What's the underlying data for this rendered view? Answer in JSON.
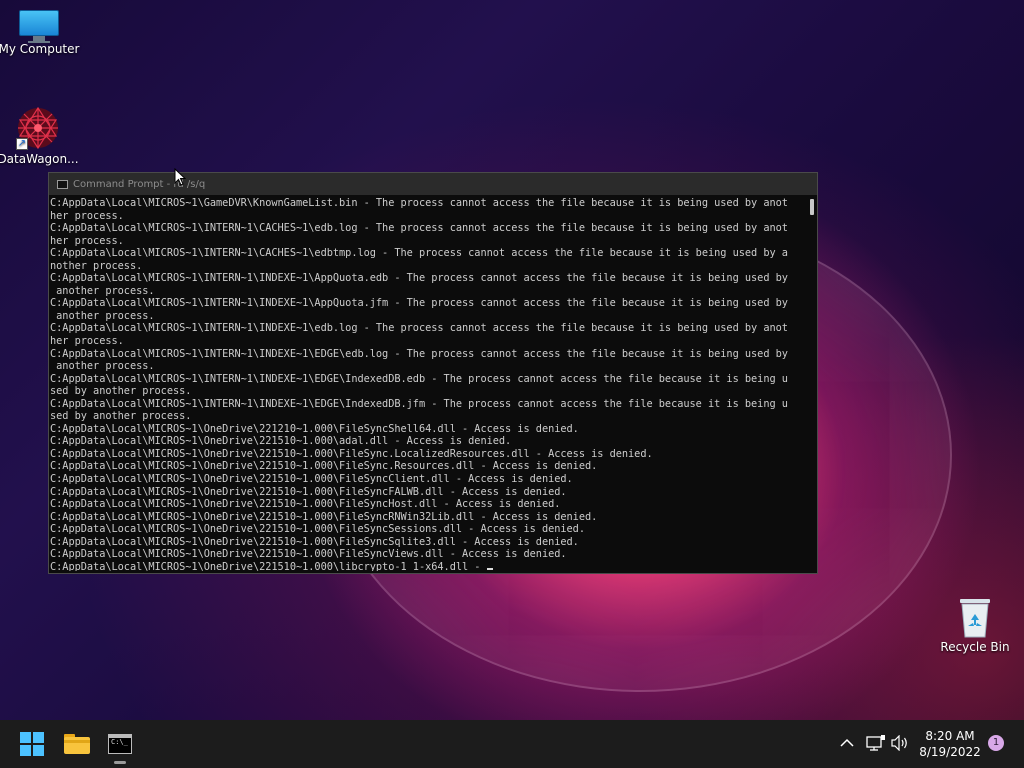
{
  "desktop": {
    "icons": [
      {
        "label": "My Computer",
        "icon": "monitor-icon"
      },
      {
        "label": "DataWagon...",
        "icon": "datawagon-icon"
      },
      {
        "label": "Recycle Bin",
        "icon": "recycle-bin-icon"
      }
    ]
  },
  "cmd_window": {
    "title": "Command Prompt - rd /s/q",
    "lines": [
      "C:AppData\\Local\\MICROS~1\\GameDVR\\KnownGameList.bin - The process cannot access the file because it is being used by anot",
      "her process.",
      "C:AppData\\Local\\MICROS~1\\INTERN~1\\CACHES~1\\edb.log - The process cannot access the file because it is being used by anot",
      "her process.",
      "C:AppData\\Local\\MICROS~1\\INTERN~1\\CACHES~1\\edbtmp.log - The process cannot access the file because it is being used by a",
      "nother process.",
      "C:AppData\\Local\\MICROS~1\\INTERN~1\\INDEXE~1\\AppQuota.edb - The process cannot access the file because it is being used by",
      " another process.",
      "C:AppData\\Local\\MICROS~1\\INTERN~1\\INDEXE~1\\AppQuota.jfm - The process cannot access the file because it is being used by",
      " another process.",
      "C:AppData\\Local\\MICROS~1\\INTERN~1\\INDEXE~1\\edb.log - The process cannot access the file because it is being used by anot",
      "her process.",
      "C:AppData\\Local\\MICROS~1\\INTERN~1\\INDEXE~1\\EDGE\\edb.log - The process cannot access the file because it is being used by",
      " another process.",
      "C:AppData\\Local\\MICROS~1\\INTERN~1\\INDEXE~1\\EDGE\\IndexedDB.edb - The process cannot access the file because it is being u",
      "sed by another process.",
      "C:AppData\\Local\\MICROS~1\\INTERN~1\\INDEXE~1\\EDGE\\IndexedDB.jfm - The process cannot access the file because it is being u",
      "sed by another process.",
      "C:AppData\\Local\\MICROS~1\\OneDrive\\221210~1.000\\FileSyncShell64.dll - Access is denied.",
      "C:AppData\\Local\\MICROS~1\\OneDrive\\221510~1.000\\adal.dll - Access is denied.",
      "C:AppData\\Local\\MICROS~1\\OneDrive\\221510~1.000\\FileSync.LocalizedResources.dll - Access is denied.",
      "C:AppData\\Local\\MICROS~1\\OneDrive\\221510~1.000\\FileSync.Resources.dll - Access is denied.",
      "C:AppData\\Local\\MICROS~1\\OneDrive\\221510~1.000\\FileSyncClient.dll - Access is denied.",
      "C:AppData\\Local\\MICROS~1\\OneDrive\\221510~1.000\\FileSyncFALWB.dll - Access is denied.",
      "C:AppData\\Local\\MICROS~1\\OneDrive\\221510~1.000\\FileSyncHost.dll - Access is denied.",
      "C:AppData\\Local\\MICROS~1\\OneDrive\\221510~1.000\\FileSyncRNWin32Lib.dll - Access is denied.",
      "C:AppData\\Local\\MICROS~1\\OneDrive\\221510~1.000\\FileSyncSessions.dll - Access is denied.",
      "C:AppData\\Local\\MICROS~1\\OneDrive\\221510~1.000\\FileSyncSqlite3.dll - Access is denied.",
      "C:AppData\\Local\\MICROS~1\\OneDrive\\221510~1.000\\FileSyncViews.dll - Access is denied.",
      "C:AppData\\Local\\MICROS~1\\OneDrive\\221510~1.000\\libcrypto-1_1-x64.dll - "
    ]
  },
  "taskbar": {
    "apps": [
      {
        "name": "start",
        "icon": "windows-logo-icon"
      },
      {
        "name": "file-explorer",
        "icon": "folder-icon"
      },
      {
        "name": "command-prompt",
        "icon": "terminal-icon",
        "active": true
      }
    ],
    "tray": {
      "time": "8:20 AM",
      "date": "8/19/2022",
      "notification_count": "1"
    }
  },
  "colors": {
    "console_bg": "#0c0c0c",
    "console_text": "#cccccc",
    "taskbar_bg": "#1c1c1c",
    "start_accent": "#4cc2ff"
  }
}
